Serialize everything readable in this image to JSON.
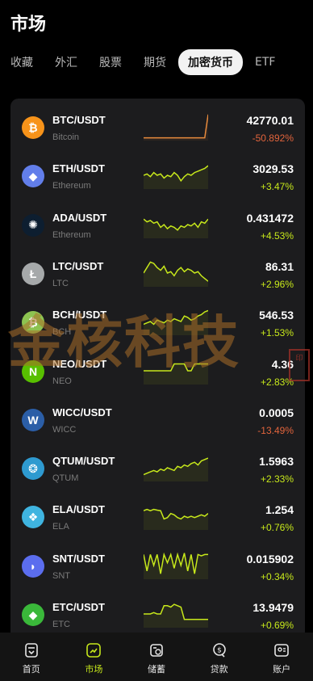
{
  "page": {
    "title": "市场"
  },
  "tabs": [
    {
      "label": "收藏",
      "active": false
    },
    {
      "label": "外汇",
      "active": false
    },
    {
      "label": "股票",
      "active": false
    },
    {
      "label": "期货",
      "active": false
    },
    {
      "label": "加密货币",
      "active": true
    },
    {
      "label": "ETF",
      "active": false
    }
  ],
  "colors": {
    "up": "#c7e81b",
    "down": "#e2643c",
    "spark_up": "#c7e81b",
    "spark_btc": "#e88a3c"
  },
  "rows": [
    {
      "pair": "BTC/USDT",
      "name": "Bitcoin",
      "price": "42770.01",
      "change": "-50.892%",
      "direction": "down",
      "icon": "bitcoin-icon",
      "icon_glyph": "₿",
      "icon_color": "#f7931a",
      "spark": [
        0.1,
        0.1,
        0.1,
        0.1,
        0.1,
        0.1,
        0.1,
        0.1,
        0.1,
        0.1,
        0.1,
        0.1,
        0.1,
        0.1,
        0.1,
        0.1,
        0.1,
        0.1,
        0.1,
        0.95
      ]
    },
    {
      "pair": "ETH/USDT",
      "name": "Ethereum",
      "price": "3029.53",
      "change": "+3.47%",
      "direction": "up",
      "icon": "ethereum-icon",
      "icon_glyph": "◆",
      "icon_color": "#627eea",
      "spark": [
        0.5,
        0.55,
        0.45,
        0.6,
        0.5,
        0.55,
        0.4,
        0.5,
        0.45,
        0.6,
        0.5,
        0.3,
        0.45,
        0.55,
        0.5,
        0.6,
        0.65,
        0.7,
        0.75,
        0.85
      ]
    },
    {
      "pair": "ADA/USDT",
      "name": "Ethereum",
      "price": "0.431472",
      "change": "+4.53%",
      "direction": "up",
      "icon": "cardano-icon",
      "icon_glyph": "✺",
      "icon_color": "#0d1e30",
      "spark": [
        0.7,
        0.6,
        0.65,
        0.55,
        0.6,
        0.4,
        0.5,
        0.35,
        0.45,
        0.4,
        0.3,
        0.45,
        0.4,
        0.5,
        0.45,
        0.55,
        0.4,
        0.6,
        0.55,
        0.7
      ]
    },
    {
      "pair": "LTC/USDT",
      "name": "LTC",
      "price": "86.31",
      "change": "+2.96%",
      "direction": "up",
      "icon": "litecoin-icon",
      "icon_glyph": "Ł",
      "icon_color": "#a6a9aa",
      "spark": [
        0.5,
        0.7,
        0.9,
        0.85,
        0.7,
        0.6,
        0.75,
        0.5,
        0.55,
        0.4,
        0.6,
        0.7,
        0.55,
        0.65,
        0.6,
        0.5,
        0.55,
        0.4,
        0.3,
        0.2
      ]
    },
    {
      "pair": "BCH/USDT",
      "name": "BCH",
      "price": "546.53",
      "change": "+1.53%",
      "direction": "up",
      "icon": "bitcoin-cash-icon",
      "icon_glyph": "₿",
      "icon_color": "#8dc351",
      "spark": [
        0.4,
        0.45,
        0.5,
        0.4,
        0.55,
        0.5,
        0.45,
        0.55,
        0.5,
        0.6,
        0.55,
        0.5,
        0.7,
        0.65,
        0.55,
        0.6,
        0.7,
        0.75,
        0.85,
        0.9
      ]
    },
    {
      "pair": "NEO/USDT",
      "name": "NEO",
      "price": "4.36",
      "change": "+2.83%",
      "direction": "up",
      "icon": "neo-icon",
      "icon_glyph": "N",
      "icon_color": "#58bf00",
      "spark": [
        0.5,
        0.5,
        0.5,
        0.5,
        0.5,
        0.5,
        0.5,
        0.5,
        0.5,
        0.75,
        0.75,
        0.75,
        0.75,
        0.5,
        0.5,
        0.75,
        0.75,
        0.75,
        0.75,
        0.75
      ]
    },
    {
      "pair": "WICC/USDT",
      "name": "WICC",
      "price": "0.0005",
      "change": "-13.49%",
      "direction": "down",
      "icon": "waykichain-icon",
      "icon_glyph": "W",
      "icon_color": "#2b5ea7",
      "spark": []
    },
    {
      "pair": "QTUM/USDT",
      "name": "QTUM",
      "price": "1.5963",
      "change": "+2.33%",
      "direction": "up",
      "icon": "qtum-icon",
      "icon_glyph": "❂",
      "icon_color": "#2e9ad0",
      "spark": [
        0.25,
        0.3,
        0.35,
        0.4,
        0.35,
        0.45,
        0.4,
        0.5,
        0.45,
        0.4,
        0.55,
        0.5,
        0.6,
        0.55,
        0.65,
        0.7,
        0.6,
        0.75,
        0.8,
        0.85
      ]
    },
    {
      "pair": "ELA/USDT",
      "name": "ELA",
      "price": "1.254",
      "change": "+0.76%",
      "direction": "up",
      "icon": "elastos-icon",
      "icon_glyph": "❖",
      "icon_color": "#3fb4e0",
      "spark": [
        0.7,
        0.75,
        0.7,
        0.75,
        0.72,
        0.7,
        0.4,
        0.45,
        0.6,
        0.55,
        0.45,
        0.4,
        0.5,
        0.45,
        0.5,
        0.45,
        0.5,
        0.55,
        0.5,
        0.6
      ]
    },
    {
      "pair": "SNT/USDT",
      "name": "SNT",
      "price": "0.015902",
      "change": "+0.34%",
      "direction": "up",
      "icon": "status-icon",
      "icon_glyph": "◗",
      "icon_color": "#5b6dee",
      "spark": [
        0.9,
        0.3,
        0.9,
        0.5,
        0.9,
        0.2,
        0.9,
        0.6,
        0.9,
        0.4,
        0.9,
        0.5,
        0.95,
        0.3,
        0.9,
        0.2,
        0.9,
        0.85,
        0.9,
        0.9
      ]
    },
    {
      "pair": "ETC/USDT",
      "name": "ETC",
      "price": "13.9479",
      "change": "+0.69%",
      "direction": "up",
      "icon": "ethereum-classic-icon",
      "icon_glyph": "◆",
      "icon_color": "#3ab83a",
      "spark": [
        0.5,
        0.5,
        0.5,
        0.55,
        0.5,
        0.5,
        0.8,
        0.8,
        0.75,
        0.85,
        0.8,
        0.75,
        0.3,
        0.3,
        0.3,
        0.3,
        0.3,
        0.3,
        0.3,
        0.3
      ]
    }
  ],
  "watermark": {
    "text": "金核科技",
    "seal": "印"
  },
  "nav": [
    {
      "label": "首页",
      "icon": "home-icon",
      "active": false
    },
    {
      "label": "市场",
      "icon": "market-icon",
      "active": true
    },
    {
      "label": "储蓄",
      "icon": "savings-icon",
      "active": false
    },
    {
      "label": "贷款",
      "icon": "loan-icon",
      "active": false
    },
    {
      "label": "账户",
      "icon": "account-icon",
      "active": false
    }
  ]
}
